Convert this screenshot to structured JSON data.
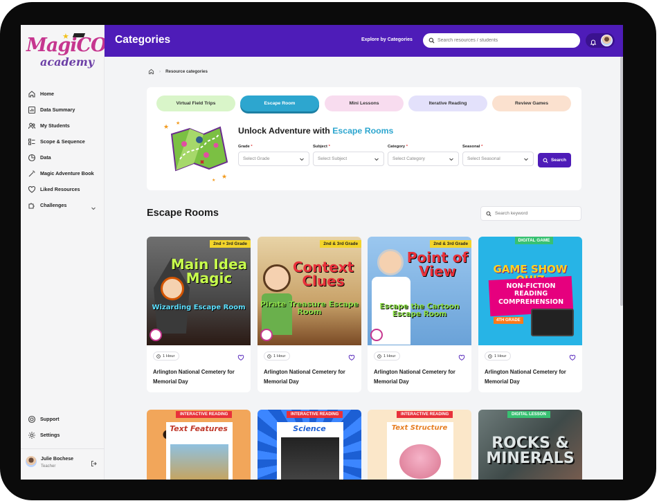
{
  "app": {
    "logo_main": "MagiCORE",
    "logo_sub": "academy"
  },
  "header": {
    "title": "Categories",
    "explore_label": "Explore by Categories",
    "search_placeholder": "Search resources / students"
  },
  "sidebar": {
    "items": [
      {
        "label": "Home",
        "icon": "home-icon"
      },
      {
        "label": "Data Summary",
        "icon": "chart-icon"
      },
      {
        "label": "My Students",
        "icon": "users-icon"
      },
      {
        "label": "Scope & Sequence",
        "icon": "list-icon"
      },
      {
        "label": "Data",
        "icon": "pie-icon"
      },
      {
        "label": "Magic Adventure Book",
        "icon": "wand-icon"
      },
      {
        "label": "Liked Resources",
        "icon": "heart-icon"
      },
      {
        "label": "Challenges",
        "icon": "puzzle-icon"
      }
    ],
    "bottom": [
      {
        "label": "Support",
        "icon": "support-icon"
      },
      {
        "label": "Settings",
        "icon": "gear-icon"
      }
    ],
    "user": {
      "name": "Julie Bochese",
      "role": "Teacher"
    }
  },
  "breadcrumb": {
    "current": "Resource categories"
  },
  "filters": {
    "tabs": [
      "Virtual Field Trips",
      "Escape Room",
      "Mini Lessons",
      "Iterative Reading",
      "Review Games"
    ],
    "active_tab": "Escape Room",
    "headline_prefix": "Unlock Adventure with ",
    "headline_accent": "Escape Rooms",
    "fields": [
      {
        "label": "Grade",
        "placeholder": "Select Grade"
      },
      {
        "label": "Subject",
        "placeholder": "Select Subject"
      },
      {
        "label": "Category",
        "placeholder": "Select Category"
      },
      {
        "label": "Seasonal",
        "placeholder": "Select Seasonal"
      }
    ],
    "required_mark": "*",
    "search_button": "Search"
  },
  "section": {
    "title": "Escape Rooms",
    "keyword_placeholder": "Search keyword"
  },
  "cards": [
    {
      "grade": "2nd + 3rd Grade",
      "thumb_title": "Main Idea Magic",
      "thumb_sub": "Wizarding Escape Room",
      "duration": "1 Hour",
      "title": "Arlington National Cemetery for Memorial Day"
    },
    {
      "grade": "2nd & 3rd Grade",
      "thumb_title": "Context Clues",
      "thumb_sub": "Pirate Treasure Escape Room",
      "duration": "1 Hour",
      "title": "Arlington National Cemetery for Memorial Day"
    },
    {
      "grade": "2nd & 3rd Grade",
      "thumb_title": "Point of View",
      "thumb_sub": "Escape the Cartoon Escape Room",
      "duration": "1 Hour",
      "title": "Arlington National Cemetery for Memorial Day"
    },
    {
      "grade": "DIGITAL GAME",
      "thumb_title": "GAME SHOW QUIZ",
      "thumb_sub": "NON-FICTION READING COMPREHENSION",
      "badge": "4TH GRADE",
      "duration": "1 Hour",
      "title": "Arlington National Cemetery for Memorial Day"
    }
  ],
  "cards_row2": [
    {
      "tag": "INTERACTIVE READING",
      "title": "Text Features"
    },
    {
      "tag": "INTERACTIVE READING",
      "title": "Science"
    },
    {
      "tag": "INTERACTIVE READING",
      "title": "Text Structure"
    },
    {
      "tag": "DIGITAL LESSON",
      "title": "ROCKS & MINERALS"
    }
  ]
}
